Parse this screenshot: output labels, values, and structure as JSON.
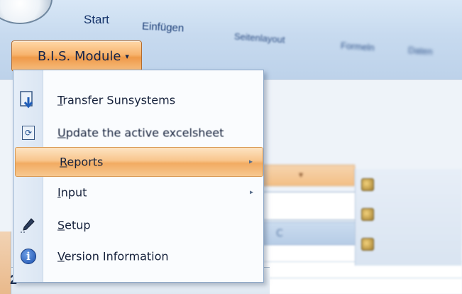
{
  "ribbon": {
    "tabs": [
      {
        "label": "Start"
      },
      {
        "label": "Einfügen"
      },
      {
        "label": "Seitenlayout"
      },
      {
        "label": "Formeln"
      },
      {
        "label": "Daten"
      }
    ],
    "module_button": {
      "label": "B.I.S. Module",
      "caret": "▾"
    }
  },
  "menu": {
    "items": [
      {
        "label_ul": "T",
        "label_rest": "ransfer Sunsystems",
        "icon": "download-document-icon"
      },
      {
        "label_ul": "U",
        "label_rest": "pdate the active excelsheet",
        "icon": "refresh-document-icon"
      },
      {
        "label_ul": "R",
        "label_rest": "eports",
        "icon": "",
        "submenu": true
      },
      {
        "label_ul": "I",
        "label_rest": "nput",
        "icon": "",
        "submenu": true
      },
      {
        "label_ul": "S",
        "label_rest": "etup",
        "icon": "pencil-icon"
      },
      {
        "label_ul": "V",
        "label_rest": "ersion Information",
        "icon": "info-icon"
      }
    ],
    "submenu_arrow": "▸",
    "highlight_color": "#f6b46d"
  },
  "sheet": {
    "column_label": "C",
    "row_number": "2"
  }
}
